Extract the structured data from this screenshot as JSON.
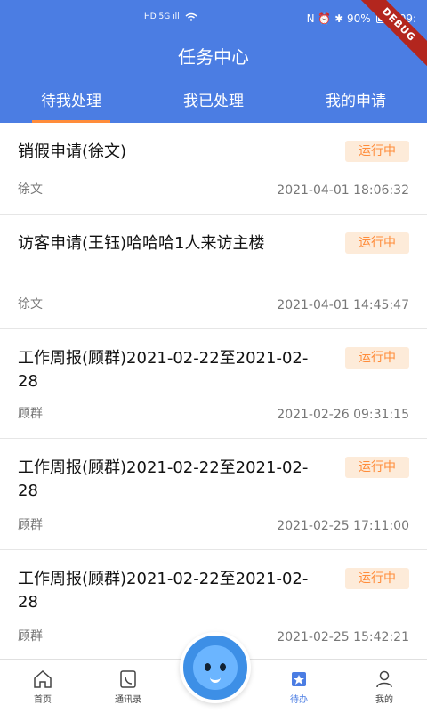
{
  "statusbar": {
    "left": "HD 5G ıll",
    "right": "N ⏰ ✱ 90%",
    "time": "09:",
    "debug": "DEBUG"
  },
  "header": {
    "title": "任务中心",
    "tabs": [
      {
        "label": "待我处理",
        "active": true
      },
      {
        "label": "我已处理",
        "active": false
      },
      {
        "label": "我的申请",
        "active": false
      }
    ]
  },
  "list": [
    {
      "title": "销假申请(徐文)",
      "status": "运行中",
      "applicant": "徐文",
      "time": "2021-04-01 18:06:32"
    },
    {
      "title": "访客申请(王钰)哈哈哈1人来访主楼",
      "status": "运行中",
      "applicant": "徐文",
      "time": "2021-04-01 14:45:47"
    },
    {
      "title": "工作周报(顾群)2021-02-22至2021-02-28",
      "status": "运行中",
      "applicant": "顾群",
      "time": "2021-02-26 09:31:15"
    },
    {
      "title": "工作周报(顾群)2021-02-22至2021-02-28",
      "status": "运行中",
      "applicant": "顾群",
      "time": "2021-02-25 17:11:00"
    },
    {
      "title": "工作周报(顾群)2021-02-22至2021-02-28",
      "status": "运行中",
      "applicant": "顾群",
      "time": "2021-02-25 15:42:21"
    }
  ],
  "bottom_nav": [
    {
      "label": "首页",
      "icon": "home-icon"
    },
    {
      "label": "通讯录",
      "icon": "contacts-icon"
    },
    {
      "label": "",
      "icon": "mascot-icon"
    },
    {
      "label": "待办",
      "icon": "todo-icon",
      "active": true
    },
    {
      "label": "我的",
      "icon": "user-icon"
    }
  ],
  "colors": {
    "primary": "#4b7de3",
    "accent": "#ff8c3a",
    "badge_bg": "#fdebd9"
  }
}
